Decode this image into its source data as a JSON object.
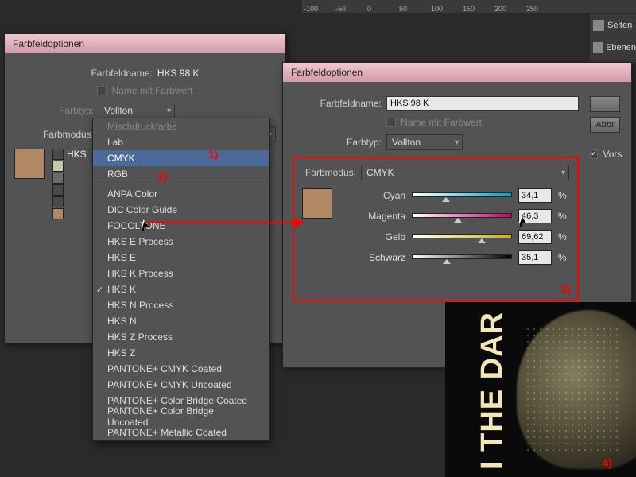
{
  "ruler": [
    "-100",
    "-50",
    "0",
    "50",
    "100",
    "150",
    "200",
    "250"
  ],
  "panels": [
    {
      "icon": "pages-icon",
      "label": "Seiten"
    },
    {
      "icon": "layers-icon",
      "label": "Ebenen"
    }
  ],
  "dialog1": {
    "title": "Farbfeldoptionen",
    "name_label": "Farbfeldname:",
    "name_value": "HKS 98 K",
    "name_with_value": "Name mit Farbwert",
    "type_label": "Farbtyp:",
    "type_value": "Vollton",
    "mode_label": "Farbmodus:",
    "mode_value": "HKS K",
    "swatch_label": "HKS"
  },
  "dropdown": {
    "items": [
      {
        "label": "Mischdruckfarbe",
        "dim": true
      },
      {
        "label": "Lab"
      },
      {
        "label": "CMYK",
        "sel": true
      },
      {
        "label": "RGB"
      },
      {
        "sep": true
      },
      {
        "label": "ANPA Color"
      },
      {
        "label": "DIC Color Guide"
      },
      {
        "label": "FOCOLTONE"
      },
      {
        "label": "HKS E Process"
      },
      {
        "label": "HKS E"
      },
      {
        "label": "HKS K Process"
      },
      {
        "label": "HKS K",
        "chk": true
      },
      {
        "label": "HKS N Process"
      },
      {
        "label": "HKS N"
      },
      {
        "label": "HKS Z Process"
      },
      {
        "label": "HKS Z"
      },
      {
        "label": "PANTONE+ CMYK Coated"
      },
      {
        "label": "PANTONE+ CMYK Uncoated"
      },
      {
        "label": "PANTONE+ Color Bridge Coated"
      },
      {
        "label": "PANTONE+ Color Bridge Uncoated"
      },
      {
        "label": "PANTONE+ Metallic Coated"
      }
    ]
  },
  "dialog2": {
    "title": "Farbfeldoptionen",
    "name_label": "Farbfeldname:",
    "name_value": "HKS 98 K",
    "name_with_value": "Name mit Farbwert",
    "type_label": "Farbtyp:",
    "type_value": "Vollton",
    "mode_label": "Farbmodus:",
    "mode_value": "CMYK",
    "btn_cancel": "Abbr",
    "chk_preview": "Vors",
    "sliders": [
      {
        "label": "Cyan",
        "value": "34,1",
        "pos": 34,
        "cls": "c"
      },
      {
        "label": "Magenta",
        "value": "46,3",
        "pos": 46,
        "cls": "m"
      },
      {
        "label": "Gelb",
        "value": "69,62",
        "pos": 70,
        "cls": "y"
      },
      {
        "label": "Schwarz",
        "value": "35,1",
        "pos": 35,
        "cls": "k"
      }
    ]
  },
  "annotations": {
    "a1": "1)",
    "a2": "2)",
    "a3": "3)",
    "a4": "4)"
  },
  "photo_text": "I THE DAR",
  "swatch_colors": [
    "#4a4a4a",
    "#c8c8a8",
    "#6a6a6a",
    "#4a4a4a",
    "#4a4a4a",
    "#b08864"
  ]
}
